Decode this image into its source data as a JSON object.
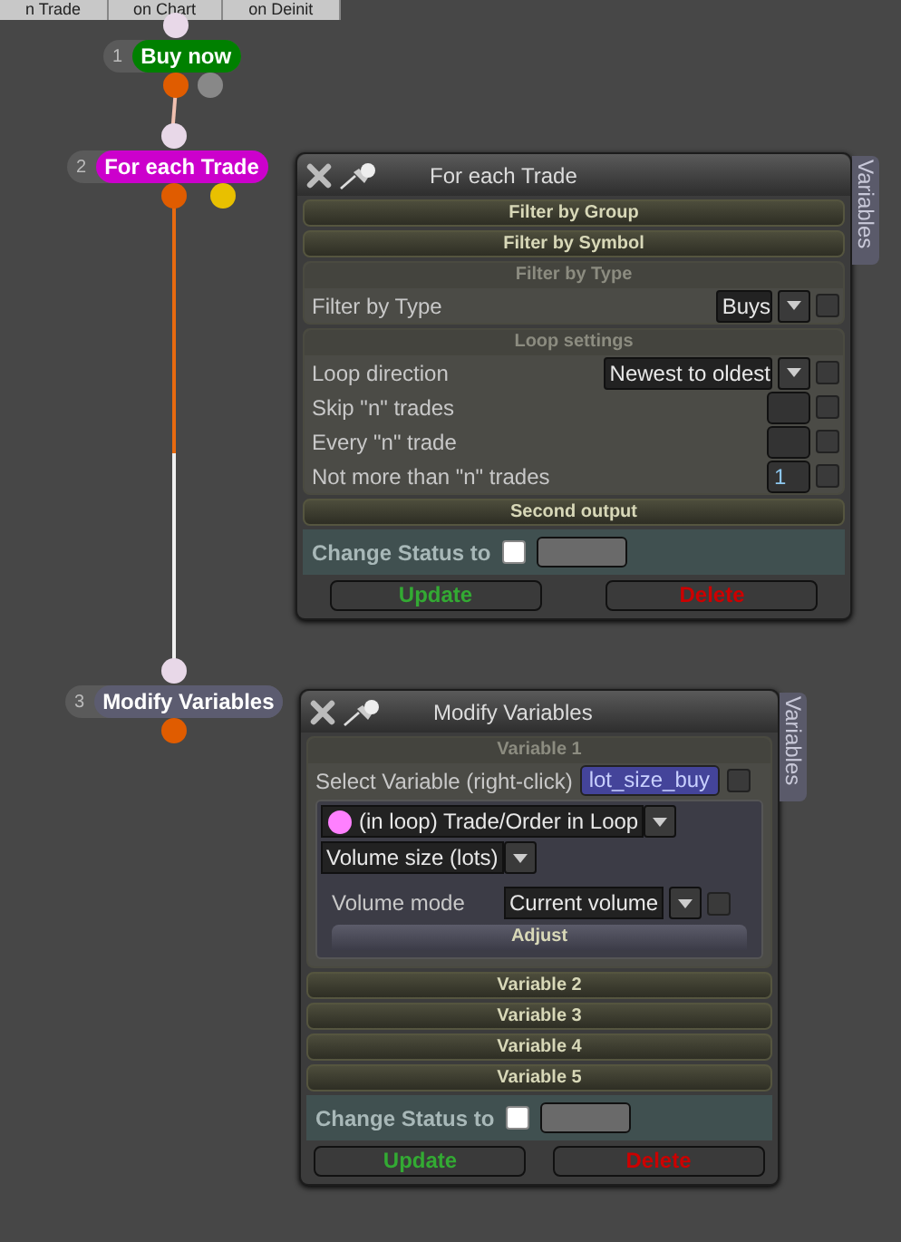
{
  "tabs": [
    {
      "label": "n Trade"
    },
    {
      "label": "on Chart"
    },
    {
      "label": "on Deinit"
    }
  ],
  "nodes": [
    {
      "number": "1",
      "label": "Buy now",
      "color": "#008000"
    },
    {
      "number": "2",
      "label": "For each Trade",
      "color": "#cc00cc"
    },
    {
      "number": "3",
      "label": "Modify Variables",
      "color": "#5c5c70"
    }
  ],
  "panels": [
    {
      "title": "For each Trade",
      "side_tab": "Variables",
      "sections": [
        {
          "kind": "header",
          "label": "Filter by Group"
        },
        {
          "kind": "header",
          "label": "Filter by Symbol"
        },
        {
          "kind": "group",
          "title": "Filter by Type",
          "rows": [
            {
              "kind": "select",
              "label": "Filter by Type",
              "value": "Buys",
              "checked": false
            }
          ]
        },
        {
          "kind": "group",
          "title": "Loop settings",
          "rows": [
            {
              "kind": "select",
              "label": "Loop direction",
              "value": "Newest to oldest",
              "checked": false
            },
            {
              "kind": "number",
              "label": "Skip \"n\" trades",
              "checked": false
            },
            {
              "kind": "number",
              "label": "Every \"n\" trade",
              "checked": false
            },
            {
              "kind": "number",
              "label": "Not more than \"n\" trades",
              "value": "1",
              "checked": false
            }
          ]
        },
        {
          "kind": "header",
          "label": "Second output"
        }
      ],
      "status_label": "Change Status to",
      "status_checked": false,
      "buttons": [
        {
          "label": "Update",
          "kind": "update"
        },
        {
          "label": "Delete",
          "kind": "delete"
        }
      ]
    },
    {
      "title": "Modify Variables",
      "side_tab": "Variables",
      "sections": [
        {
          "kind": "group",
          "title": "Variable 1",
          "rows": [
            {
              "kind": "variable",
              "label": "Select Variable (right-click)",
              "value": "lot_size_buy",
              "checked": false
            },
            {
              "kind": "subpanel",
              "items": [
                {
                  "kind": "source",
                  "value": "(in loop) Trade/Order in Loop",
                  "color": "#ff80ff"
                },
                {
                  "kind": "plain",
                  "value": "Volume size (lots)"
                },
                {
                  "kind": "select",
                  "label": "Volume mode",
                  "value": "Current volume",
                  "checked": false
                },
                {
                  "kind": "button",
                  "label": "Adjust"
                }
              ]
            }
          ]
        },
        {
          "kind": "header",
          "label": "Variable 2"
        },
        {
          "kind": "header",
          "label": "Variable 3"
        },
        {
          "kind": "header",
          "label": "Variable 4"
        },
        {
          "kind": "header",
          "label": "Variable 5"
        }
      ],
      "status_label": "Change Status to",
      "status_checked": false,
      "buttons": [
        {
          "label": "Update",
          "kind": "update"
        },
        {
          "label": "Delete",
          "kind": "delete"
        }
      ]
    }
  ]
}
